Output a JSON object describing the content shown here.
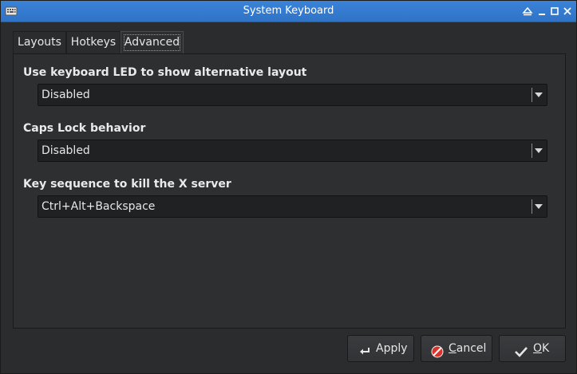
{
  "window": {
    "title": "System Keyboard",
    "app_icon": "keyboard-icon",
    "controls": [
      "shade-icon",
      "minimize-icon",
      "maximize-icon",
      "close-icon"
    ]
  },
  "tabs": [
    {
      "label": "Layouts",
      "active": false
    },
    {
      "label": "Hotkeys",
      "active": false
    },
    {
      "label": "Advanced",
      "active": true
    }
  ],
  "advanced": {
    "led": {
      "label": "Use keyboard LED to show alternative layout",
      "value": "Disabled"
    },
    "caps": {
      "label": "Caps Lock behavior",
      "value": "Disabled"
    },
    "kill": {
      "label": "Key sequence to kill the X server",
      "value": "Ctrl+Alt+Backspace"
    }
  },
  "buttons": {
    "apply": {
      "label": "Apply",
      "icon": "enter-arrow-icon"
    },
    "cancel": {
      "first": "C",
      "rest": "ancel",
      "icon": "no-entry-icon",
      "accent": "#d9342b"
    },
    "ok": {
      "first": "O",
      "rest": "K",
      "icon": "checkmark-icon"
    }
  },
  "colors": {
    "titlebar": "#2f73c6",
    "accent": "#3c8ef0",
    "background": "#2b2c2e"
  }
}
